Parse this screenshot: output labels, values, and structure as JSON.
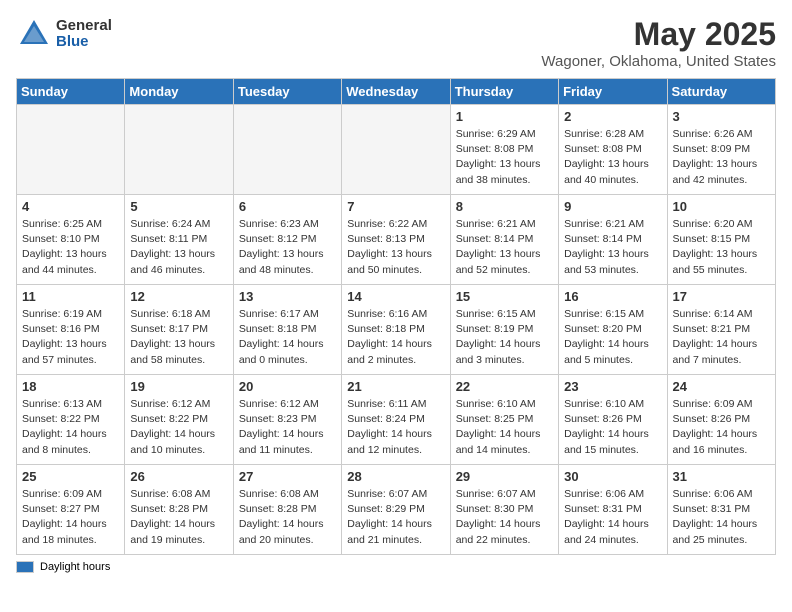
{
  "header": {
    "logo_general": "General",
    "logo_blue": "Blue",
    "title": "May 2025",
    "subtitle": "Wagoner, Oklahoma, United States"
  },
  "weekdays": [
    "Sunday",
    "Monday",
    "Tuesday",
    "Wednesday",
    "Thursday",
    "Friday",
    "Saturday"
  ],
  "weeks": [
    [
      {
        "day": "",
        "info": ""
      },
      {
        "day": "",
        "info": ""
      },
      {
        "day": "",
        "info": ""
      },
      {
        "day": "",
        "info": ""
      },
      {
        "day": "1",
        "info": "Sunrise: 6:29 AM\nSunset: 8:08 PM\nDaylight: 13 hours\nand 38 minutes."
      },
      {
        "day": "2",
        "info": "Sunrise: 6:28 AM\nSunset: 8:08 PM\nDaylight: 13 hours\nand 40 minutes."
      },
      {
        "day": "3",
        "info": "Sunrise: 6:26 AM\nSunset: 8:09 PM\nDaylight: 13 hours\nand 42 minutes."
      }
    ],
    [
      {
        "day": "4",
        "info": "Sunrise: 6:25 AM\nSunset: 8:10 PM\nDaylight: 13 hours\nand 44 minutes."
      },
      {
        "day": "5",
        "info": "Sunrise: 6:24 AM\nSunset: 8:11 PM\nDaylight: 13 hours\nand 46 minutes."
      },
      {
        "day": "6",
        "info": "Sunrise: 6:23 AM\nSunset: 8:12 PM\nDaylight: 13 hours\nand 48 minutes."
      },
      {
        "day": "7",
        "info": "Sunrise: 6:22 AM\nSunset: 8:13 PM\nDaylight: 13 hours\nand 50 minutes."
      },
      {
        "day": "8",
        "info": "Sunrise: 6:21 AM\nSunset: 8:14 PM\nDaylight: 13 hours\nand 52 minutes."
      },
      {
        "day": "9",
        "info": "Sunrise: 6:21 AM\nSunset: 8:14 PM\nDaylight: 13 hours\nand 53 minutes."
      },
      {
        "day": "10",
        "info": "Sunrise: 6:20 AM\nSunset: 8:15 PM\nDaylight: 13 hours\nand 55 minutes."
      }
    ],
    [
      {
        "day": "11",
        "info": "Sunrise: 6:19 AM\nSunset: 8:16 PM\nDaylight: 13 hours\nand 57 minutes."
      },
      {
        "day": "12",
        "info": "Sunrise: 6:18 AM\nSunset: 8:17 PM\nDaylight: 13 hours\nand 58 minutes."
      },
      {
        "day": "13",
        "info": "Sunrise: 6:17 AM\nSunset: 8:18 PM\nDaylight: 14 hours\nand 0 minutes."
      },
      {
        "day": "14",
        "info": "Sunrise: 6:16 AM\nSunset: 8:18 PM\nDaylight: 14 hours\nand 2 minutes."
      },
      {
        "day": "15",
        "info": "Sunrise: 6:15 AM\nSunset: 8:19 PM\nDaylight: 14 hours\nand 3 minutes."
      },
      {
        "day": "16",
        "info": "Sunrise: 6:15 AM\nSunset: 8:20 PM\nDaylight: 14 hours\nand 5 minutes."
      },
      {
        "day": "17",
        "info": "Sunrise: 6:14 AM\nSunset: 8:21 PM\nDaylight: 14 hours\nand 7 minutes."
      }
    ],
    [
      {
        "day": "18",
        "info": "Sunrise: 6:13 AM\nSunset: 8:22 PM\nDaylight: 14 hours\nand 8 minutes."
      },
      {
        "day": "19",
        "info": "Sunrise: 6:12 AM\nSunset: 8:22 PM\nDaylight: 14 hours\nand 10 minutes."
      },
      {
        "day": "20",
        "info": "Sunrise: 6:12 AM\nSunset: 8:23 PM\nDaylight: 14 hours\nand 11 minutes."
      },
      {
        "day": "21",
        "info": "Sunrise: 6:11 AM\nSunset: 8:24 PM\nDaylight: 14 hours\nand 12 minutes."
      },
      {
        "day": "22",
        "info": "Sunrise: 6:10 AM\nSunset: 8:25 PM\nDaylight: 14 hours\nand 14 minutes."
      },
      {
        "day": "23",
        "info": "Sunrise: 6:10 AM\nSunset: 8:26 PM\nDaylight: 14 hours\nand 15 minutes."
      },
      {
        "day": "24",
        "info": "Sunrise: 6:09 AM\nSunset: 8:26 PM\nDaylight: 14 hours\nand 16 minutes."
      }
    ],
    [
      {
        "day": "25",
        "info": "Sunrise: 6:09 AM\nSunset: 8:27 PM\nDaylight: 14 hours\nand 18 minutes."
      },
      {
        "day": "26",
        "info": "Sunrise: 6:08 AM\nSunset: 8:28 PM\nDaylight: 14 hours\nand 19 minutes."
      },
      {
        "day": "27",
        "info": "Sunrise: 6:08 AM\nSunset: 8:28 PM\nDaylight: 14 hours\nand 20 minutes."
      },
      {
        "day": "28",
        "info": "Sunrise: 6:07 AM\nSunset: 8:29 PM\nDaylight: 14 hours\nand 21 minutes."
      },
      {
        "day": "29",
        "info": "Sunrise: 6:07 AM\nSunset: 8:30 PM\nDaylight: 14 hours\nand 22 minutes."
      },
      {
        "day": "30",
        "info": "Sunrise: 6:06 AM\nSunset: 8:31 PM\nDaylight: 14 hours\nand 24 minutes."
      },
      {
        "day": "31",
        "info": "Sunrise: 6:06 AM\nSunset: 8:31 PM\nDaylight: 14 hours\nand 25 minutes."
      }
    ]
  ],
  "legend": {
    "daylight_label": "Daylight hours"
  }
}
